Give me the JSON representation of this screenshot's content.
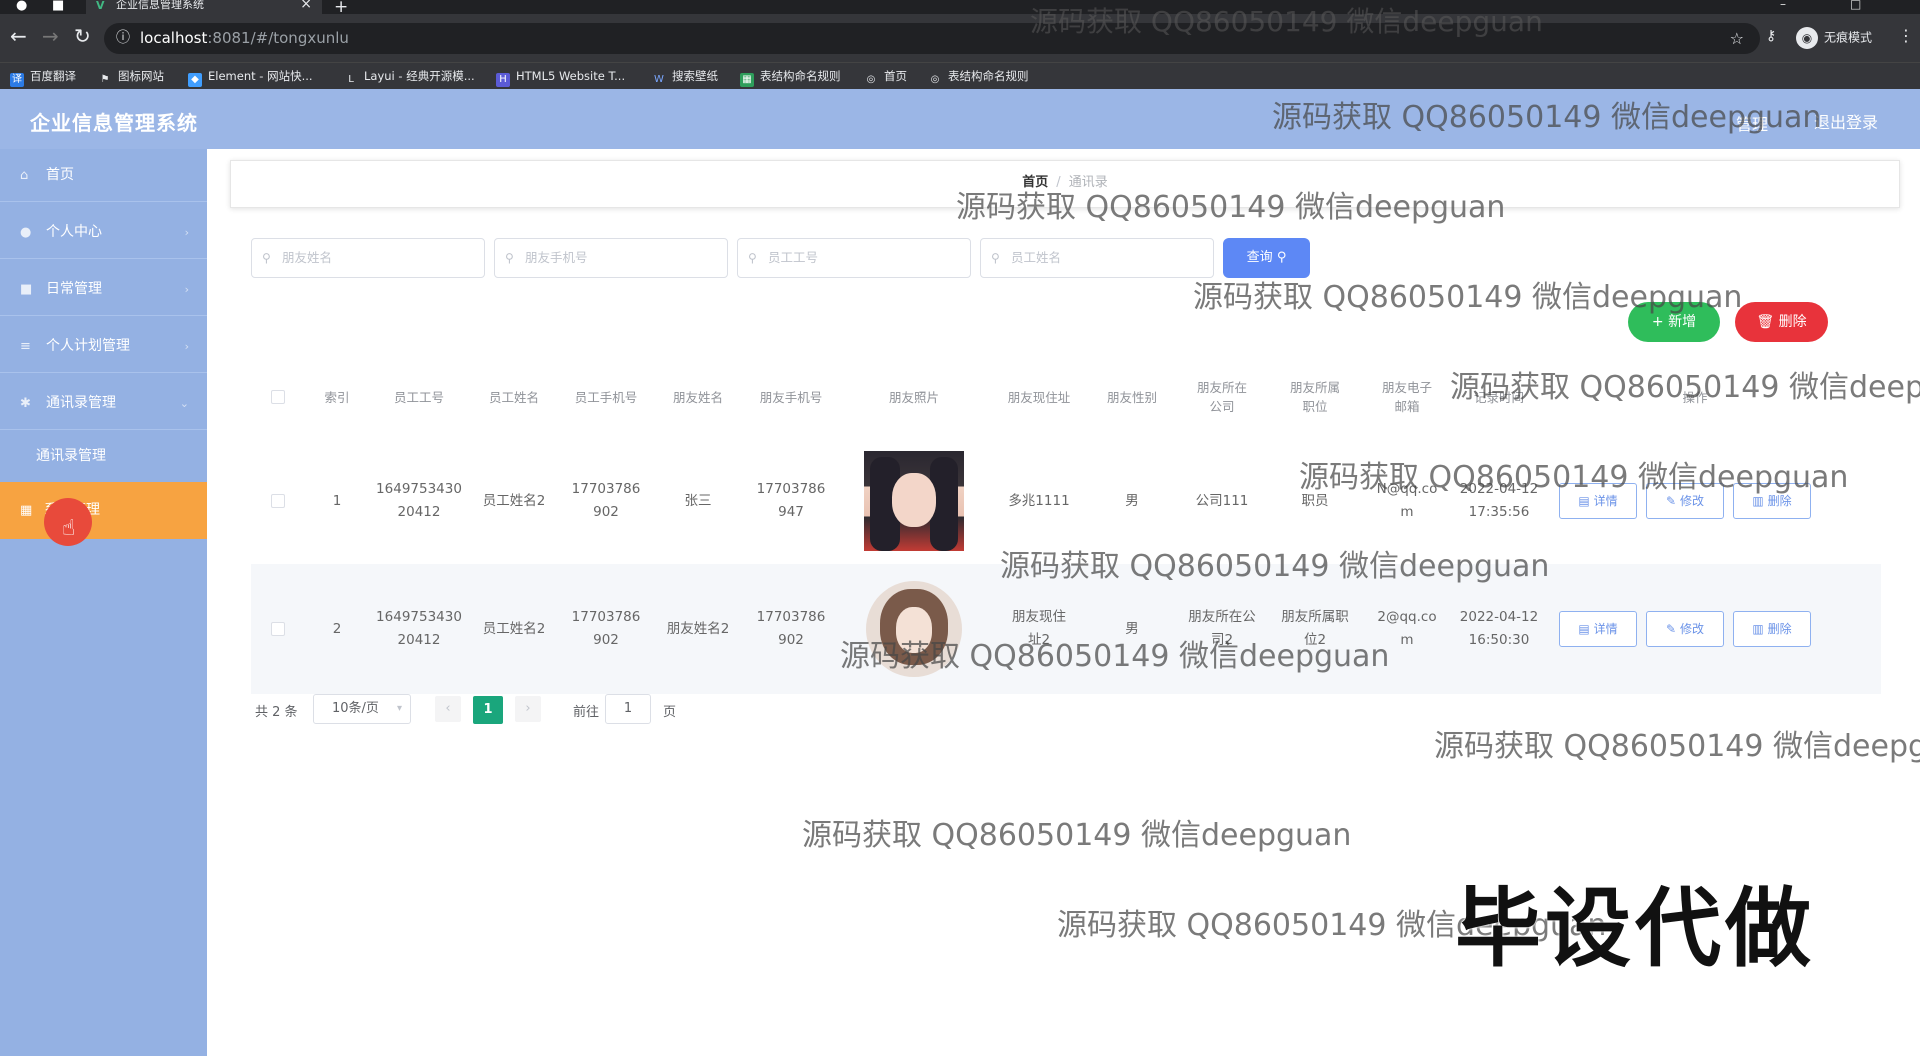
{
  "browser": {
    "tab_title": "企业信息管理系统",
    "url_host": "localhost",
    "url_path": ":8081/#/tongxunlu",
    "profile_label": "无痕模式",
    "bookmarks": [
      "百度翻译",
      "图标网站",
      "Element - 网站快...",
      "Layui - 经典开源模...",
      "HTML5 Website T...",
      "搜索壁纸",
      "表结构命名规则",
      "首页",
      "表结构命名规则"
    ]
  },
  "header": {
    "title": "企业信息管理系统",
    "user_label": "管理",
    "logout": "退出登录"
  },
  "sidebar": {
    "items": [
      {
        "label": "首页",
        "icon": "home-icon"
      },
      {
        "label": "个人中心",
        "icon": "user-icon"
      },
      {
        "label": "日常管理",
        "icon": "doc-icon"
      },
      {
        "label": "个人计划管理",
        "icon": "list-icon"
      },
      {
        "label": "通讯录管理",
        "icon": "gear-icon"
      }
    ],
    "sub_item": "通讯录管理",
    "active_item": "系统管理"
  },
  "breadcrumb": {
    "home": "首页",
    "current": "通讯录"
  },
  "search": {
    "friend_name_placeholder": "朋友姓名",
    "friend_phone_placeholder": "朋友手机号",
    "emp_no_placeholder": "员工工号",
    "emp_name_placeholder": "员工姓名",
    "query_button": "查询"
  },
  "actions": {
    "add": "新增",
    "delete": "删除"
  },
  "table": {
    "headers": [
      "索引",
      "员工工号",
      "员工姓名",
      "员工手机号",
      "朋友姓名",
      "朋友手机号",
      "朋友照片",
      "朋友现住址",
      "朋友性别",
      "朋友所在公司",
      "朋友所属职位",
      "朋友电子邮箱",
      "记录时间",
      "操作"
    ],
    "rows": [
      {
        "index": "1",
        "emp_no": "1649753430 20412",
        "emp_name": "员工姓名2",
        "emp_phone": "17703786902",
        "friend_name": "张三",
        "friend_phone": "17703786947",
        "address": "多兆1111",
        "gender": "男",
        "company": "公司111",
        "position": "职员",
        "email": "N@qq.com",
        "time": "2022-04-12 17:35:56"
      },
      {
        "index": "2",
        "emp_no": "1649753430 20412",
        "emp_name": "员工姓名2",
        "emp_phone": "17703786902",
        "friend_name": "朋友姓名2",
        "friend_phone": "17703786902",
        "address": "朋友现住址2",
        "gender": "男",
        "company": "朋友所在公司2",
        "position": "朋友所属职位2",
        "email": "2@qq.com",
        "time": "2022-04-12 16:50:30"
      }
    ],
    "row_buttons": {
      "detail": "详情",
      "edit": "修改",
      "delete": "删除"
    }
  },
  "pagination": {
    "total": "共 2 条",
    "page_size": "10条/页",
    "current_page": "1",
    "goto_label": "前往",
    "goto_value": "1",
    "page_suffix": "页"
  },
  "overlay": {
    "watermark": "源码获取 QQ86050149 微信deepguan",
    "stamp": "毕设代做"
  }
}
